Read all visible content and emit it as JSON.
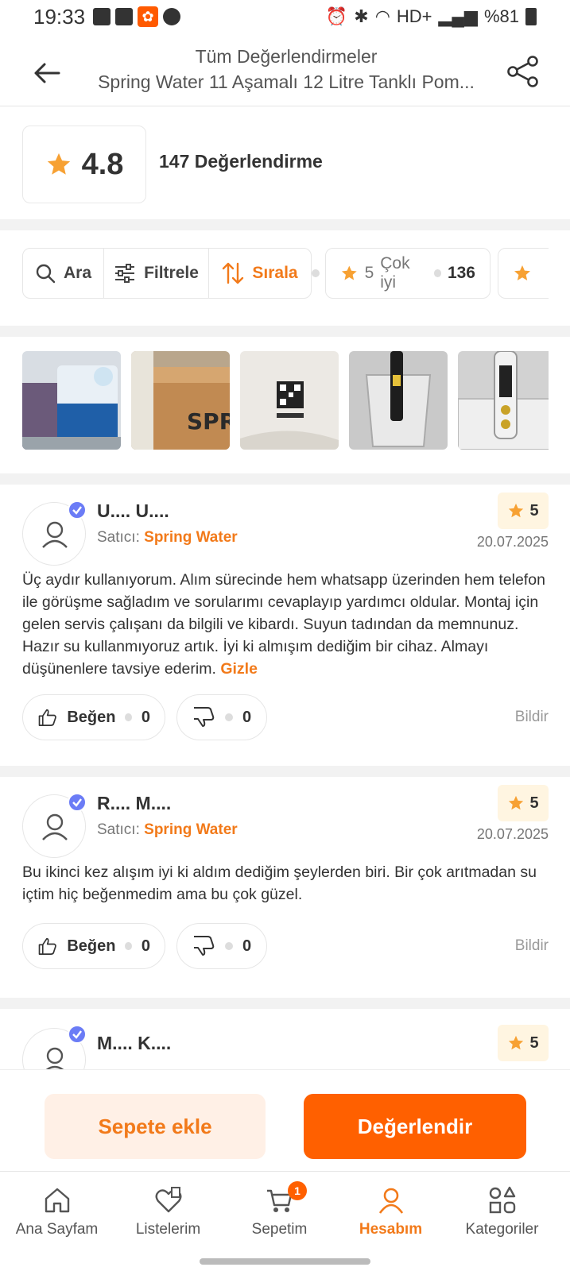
{
  "status_bar": {
    "time": "19:33",
    "battery": "%81",
    "network": "HD+"
  },
  "header": {
    "title": "Tüm Değerlendirmeler",
    "subtitle": "Spring Water 11  Aşamalı  12 Litre Tanklı Pom..."
  },
  "summary": {
    "rating": "4.8",
    "count_label": "147 Değerlendirme"
  },
  "filters": {
    "search_label": "Ara",
    "filter_label": "Filtrele",
    "sort_label": "Sırala",
    "star_chip": {
      "stars": "5",
      "label": "Çok iyi",
      "count": "136"
    }
  },
  "colors": {
    "accent": "#f27a1a",
    "primary_button": "#ff6000",
    "verified": "#6b7cf6",
    "star": "#f7a133"
  },
  "reviews": [
    {
      "name": "U.... U....",
      "seller_prefix": "Satıcı:",
      "seller": "Spring Water",
      "stars": "5",
      "date": "20.07.2025",
      "text": "Üç aydır kullanıyorum. Alım sürecinde hem whatsapp üzerinden hem telefon ile görüşme sağladım ve sorularımı cevaplayıp yardımcı oldular. Montaj için gelen servis çalışanı da bilgili ve kibardı. Suyun tadından da memnunuz. Hazır su kullanmıyoruz artık. İyi ki almışım dediğim bir cihaz. Almayı düşünenlere tavsiye ederim.",
      "hide_label": "Gizle",
      "like_label": "Beğen",
      "likes": "0",
      "dislikes": "0",
      "report_label": "Bildir"
    },
    {
      "name": "R.... M....",
      "seller_prefix": "Satıcı:",
      "seller": "Spring Water",
      "stars": "5",
      "date": "20.07.2025",
      "text": "Bu ikinci kez alışım iyi ki aldım dediğim şeylerden biri. Bir çok arıtmadan su içtim hiç beğenmedim ama bu çok güzel.",
      "like_label": "Beğen",
      "likes": "0",
      "dislikes": "0",
      "report_label": "Bildir"
    },
    {
      "name": "M.... K....",
      "stars": "5"
    }
  ],
  "actions": {
    "add_to_cart": "Sepete ekle",
    "review": "Değerlendir"
  },
  "nav": {
    "items": [
      {
        "label": "Ana Sayfam",
        "icon": "home-icon"
      },
      {
        "label": "Listelerim",
        "icon": "heart-list-icon"
      },
      {
        "label": "Sepetim",
        "icon": "cart-icon",
        "badge": "1"
      },
      {
        "label": "Hesabım",
        "icon": "user-icon",
        "active": true
      },
      {
        "label": "Kategoriler",
        "icon": "categories-icon"
      }
    ]
  }
}
